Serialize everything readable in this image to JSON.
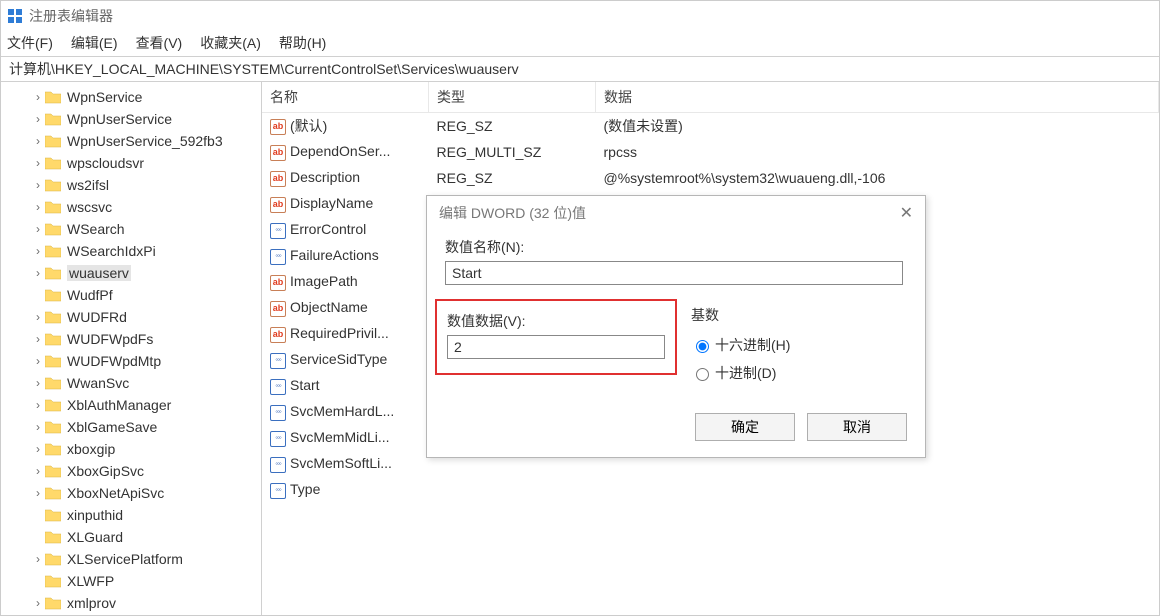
{
  "app": {
    "title": "注册表编辑器"
  },
  "menu": {
    "file": "文件(F)",
    "edit": "编辑(E)",
    "view": "查看(V)",
    "fav": "收藏夹(A)",
    "help": "帮助(H)"
  },
  "address": "计算机\\HKEY_LOCAL_MACHINE\\SYSTEM\\CurrentControlSet\\Services\\wuauserv",
  "tree": {
    "items": [
      {
        "label": "WpnService",
        "indent": 2
      },
      {
        "label": "WpnUserService",
        "indent": 2
      },
      {
        "label": "WpnUserService_592fb3",
        "indent": 2
      },
      {
        "label": "wpscloudsvr",
        "indent": 2
      },
      {
        "label": "ws2ifsl",
        "indent": 2
      },
      {
        "label": "wscsvc",
        "indent": 2
      },
      {
        "label": "WSearch",
        "indent": 2
      },
      {
        "label": "WSearchIdxPi",
        "indent": 2
      },
      {
        "label": "wuauserv",
        "indent": 2,
        "selected": true
      },
      {
        "label": "WudfPf",
        "indent": 2,
        "nocaret": true
      },
      {
        "label": "WUDFRd",
        "indent": 2
      },
      {
        "label": "WUDFWpdFs",
        "indent": 2
      },
      {
        "label": "WUDFWpdMtp",
        "indent": 2
      },
      {
        "label": "WwanSvc",
        "indent": 2
      },
      {
        "label": "XblAuthManager",
        "indent": 2
      },
      {
        "label": "XblGameSave",
        "indent": 2
      },
      {
        "label": "xboxgip",
        "indent": 2
      },
      {
        "label": "XboxGipSvc",
        "indent": 2
      },
      {
        "label": "XboxNetApiSvc",
        "indent": 2
      },
      {
        "label": "xinputhid",
        "indent": 2,
        "nocaret": true
      },
      {
        "label": "XLGuard",
        "indent": 2,
        "nocaret": true
      },
      {
        "label": "XLServicePlatform",
        "indent": 2
      },
      {
        "label": "XLWFP",
        "indent": 2,
        "nocaret": true
      },
      {
        "label": "xmlprov",
        "indent": 2
      }
    ]
  },
  "list": {
    "headers": {
      "name": "名称",
      "type": "类型",
      "data": "数据"
    },
    "rows": [
      {
        "icon": "ab",
        "name": "(默认)",
        "type": "REG_SZ",
        "data": "(数值未设置)"
      },
      {
        "icon": "ab",
        "name": "DependOnSer...",
        "type": "REG_MULTI_SZ",
        "data": "rpcss"
      },
      {
        "icon": "ab",
        "name": "Description",
        "type": "REG_SZ",
        "data": "@%systemroot%\\system32\\wuaueng.dll,-106"
      },
      {
        "icon": "ab",
        "name": "DisplayName",
        "type": "",
        "data": ""
      },
      {
        "icon": "bin",
        "name": "ErrorControl",
        "type": "",
        "data": ""
      },
      {
        "icon": "bin",
        "name": "FailureActions",
        "type": "",
        "data": ""
      },
      {
        "icon": "ab",
        "name": "ImagePath",
        "type": "",
        "data": ""
      },
      {
        "icon": "ab",
        "name": "ObjectName",
        "type": "",
        "data": ""
      },
      {
        "icon": "ab",
        "name": "RequiredPrivil...",
        "type": "",
        "data": ""
      },
      {
        "icon": "bin",
        "name": "ServiceSidType",
        "type": "",
        "data": ""
      },
      {
        "icon": "bin",
        "name": "Start",
        "type": "",
        "data": ""
      },
      {
        "icon": "bin",
        "name": "SvcMemHardL...",
        "type": "",
        "data": ""
      },
      {
        "icon": "bin",
        "name": "SvcMemMidLi...",
        "type": "",
        "data": ""
      },
      {
        "icon": "bin",
        "name": "SvcMemSoftLi...",
        "type": "",
        "data": ""
      },
      {
        "icon": "bin",
        "name": "Type",
        "type": "",
        "data": ""
      }
    ]
  },
  "dialog": {
    "title": "编辑 DWORD (32 位)值",
    "name_label": "数值名称(N):",
    "name_value": "Start",
    "data_label": "数值数据(V):",
    "data_value": "2",
    "base_label": "基数",
    "hex_label": "十六进制(H)",
    "dec_label": "十进制(D)",
    "ok": "确定",
    "cancel": "取消"
  }
}
